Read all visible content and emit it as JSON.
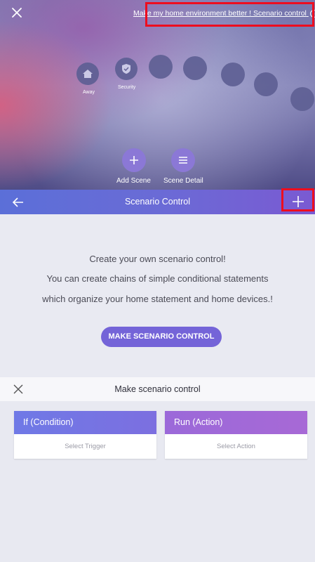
{
  "hero": {
    "link_text": "Make my home environment better ! Scenario control",
    "chevron": "›",
    "bubbles": [
      {
        "label": "Away",
        "icon": "home-icon"
      },
      {
        "label": "Security",
        "icon": "shield-icon"
      }
    ],
    "actions": [
      {
        "label": "Add Scene",
        "icon": "plus-icon"
      },
      {
        "label": "Scene Detail",
        "icon": "list-icon"
      }
    ]
  },
  "topbar": {
    "title": "Scenario Control"
  },
  "empty_state": {
    "line1": "Create your own scenario control!",
    "line2": "You can create chains of simple conditional statements",
    "line3": "which organize your home statement and home devices.!",
    "button": "MAKE SCENARIO CONTROL"
  },
  "sheet": {
    "title": "Make scenario control",
    "condition": {
      "title": "If (Condition)",
      "placeholder": "Select Trigger"
    },
    "action": {
      "title": "Run (Action)",
      "placeholder": "Select Action"
    }
  },
  "colors": {
    "highlight": "#ee0d1f",
    "accent": "#7464d8",
    "condition": "#6f79e6",
    "action": "#a769d6"
  }
}
